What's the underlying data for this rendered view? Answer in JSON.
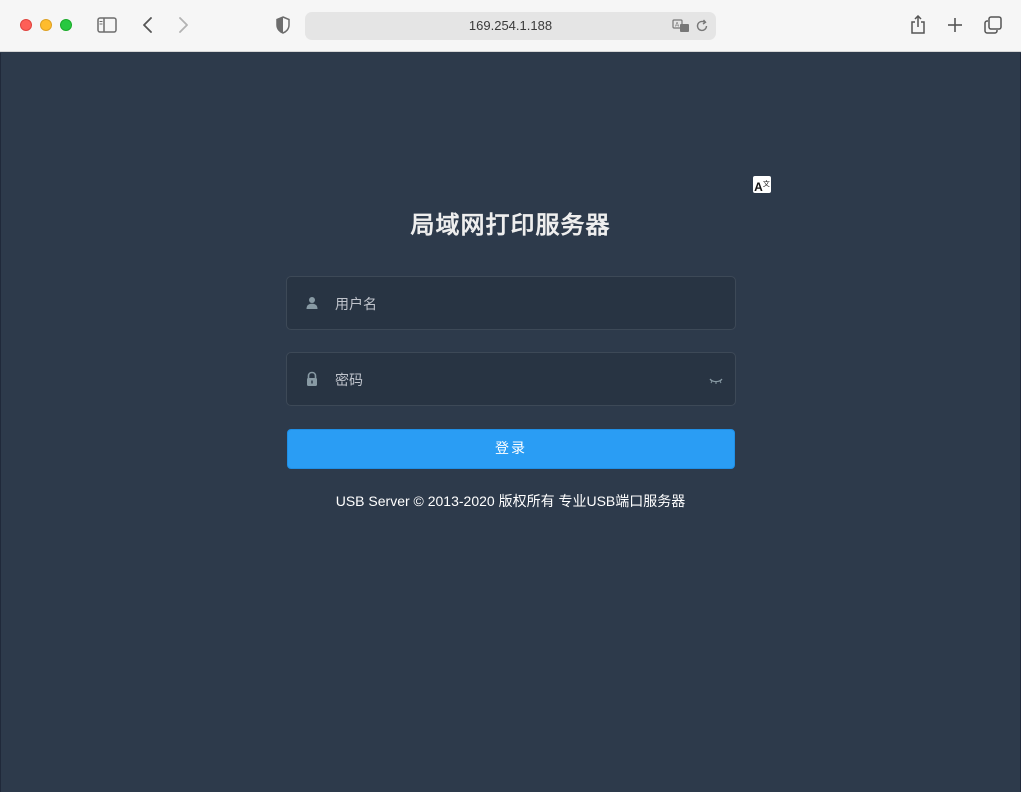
{
  "browser": {
    "url": "169.254.1.188",
    "icons": [
      "sidebar-icon",
      "back-icon",
      "forward-icon",
      "shield-icon",
      "translate-icon",
      "reload-icon",
      "share-icon",
      "new-tab-icon",
      "tabs-overview-icon"
    ]
  },
  "page": {
    "translate_badge": "A",
    "title": "局域网打印服务器",
    "username_placeholder": "用户名",
    "password_placeholder": "密码",
    "login_label": "登录",
    "footer": "USB Server © 2013-2020 版权所有 专业USB端口服务器"
  },
  "colors": {
    "background": "#2d3a4b",
    "input_bg": "#283443",
    "primary_button": "#2a9df4"
  }
}
